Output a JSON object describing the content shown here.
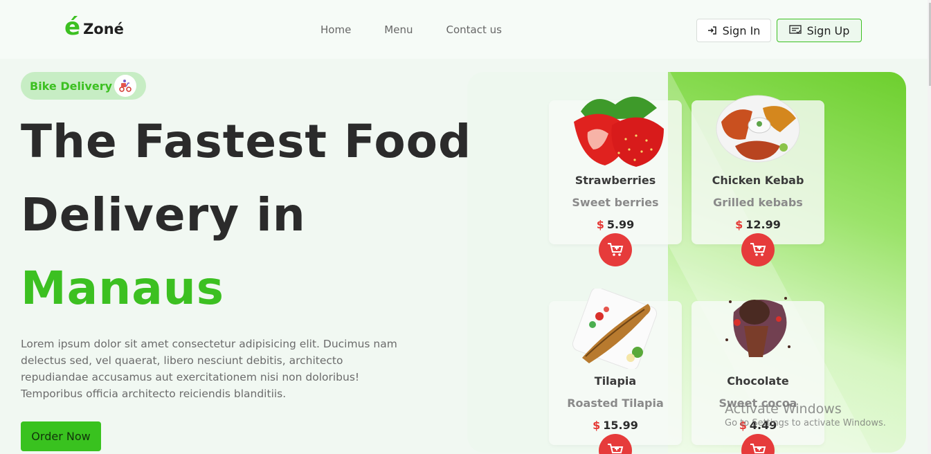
{
  "brand": {
    "mark": "é",
    "name": "Zoné"
  },
  "nav": {
    "items": [
      "Home",
      "Menu",
      "Contact us"
    ]
  },
  "auth": {
    "sign_in": "Sign In",
    "sign_up": "Sign Up"
  },
  "hero": {
    "badge": "Bike Delivery",
    "line1": "The Fastest Food",
    "line2": "Delivery in",
    "line3": "Manaus",
    "description": "Lorem ipsum dolor sit amet consectetur adipisicing elit. Ducimus nam delectus sed, vel quaerat, libero nesciunt debitis, architecto repudiandae accusamus aut exercitationem nisi non doloribus! Temporibus officia architecto reiciendis blanditiis.",
    "cta": "Order Now"
  },
  "products": [
    {
      "name": "Strawberries",
      "subtitle": "Sweet berries",
      "currency": "$",
      "price": "5.99"
    },
    {
      "name": "Chicken Kebab",
      "subtitle": "Grilled kebabs",
      "currency": "$",
      "price": "12.99"
    },
    {
      "name": "Tilapia",
      "subtitle": "Roasted Tilapia",
      "currency": "$",
      "price": "15.99"
    },
    {
      "name": "Chocolate",
      "subtitle": "Sweet cocoa",
      "currency": "$",
      "price": "4.49"
    }
  ],
  "watermark": {
    "title": "Activate Windows",
    "subtitle": "Go to Settings to activate Windows."
  },
  "colors": {
    "accent": "#3cc021",
    "price_symbol": "#e53935",
    "cart_button": "#e63b3b"
  }
}
